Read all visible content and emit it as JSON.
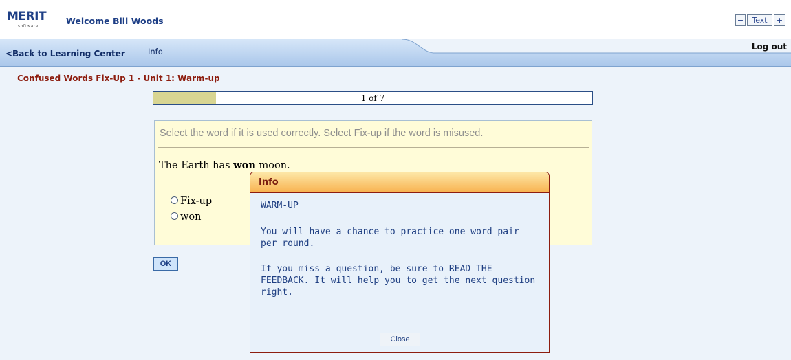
{
  "header": {
    "logo_word": "MERIT",
    "logo_tag": "software",
    "welcome": "Welcome Bill Woods",
    "text_size": {
      "minus": "−",
      "label": "Text",
      "plus": "+"
    }
  },
  "nav": {
    "back_label": "<Back to Learning Center",
    "info_label": "Info",
    "logout_label": "Log out"
  },
  "lesson": {
    "title": "Confused Words Fix-Up 1 - Unit 1: Warm-up",
    "progress": {
      "current": 1,
      "total": 7,
      "label": "1 of 7",
      "fraction": 0.143
    }
  },
  "question": {
    "instruction": "Select the word if it is used correctly. Select Fix-up if the word is misused.",
    "sentence_before": "The Earth has ",
    "sentence_word": "won",
    "sentence_after": " moon.",
    "options": [
      "Fix-up",
      "won"
    ],
    "ok_label": "OK"
  },
  "dialog": {
    "title": "Info",
    "heading": "WARM-UP",
    "para1": "You will have a chance to practice one word pair per round.",
    "para2": "If you miss a question, be sure to READ THE FEEDBACK. It will help you to get the next question right.",
    "close_label": "Close"
  },
  "colors": {
    "brand_blue": "#1e3f86",
    "lesson_red": "#8d1d0f",
    "progress_fill": "#d8d592",
    "question_bg": "#fffcd8",
    "dialog_bg": "#e8f1fa"
  }
}
